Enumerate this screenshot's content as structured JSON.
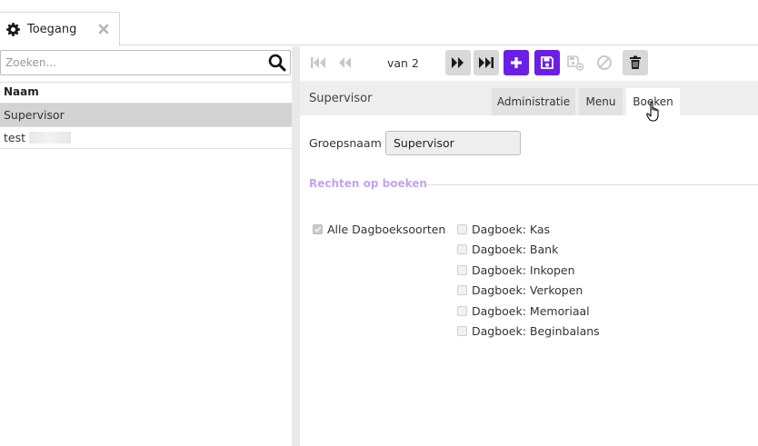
{
  "tabs": [
    {
      "label": "Toegang",
      "icon": "gear-icon",
      "closable": true
    }
  ],
  "left_panel": {
    "search": {
      "placeholder": "Zoeken...",
      "value": ""
    },
    "column_header": "Naam",
    "rows": [
      {
        "label": "Supervisor",
        "selected": true
      },
      {
        "label": "test",
        "selected": false
      }
    ]
  },
  "toolbar": {
    "page_text": "van 2",
    "buttons": [
      "first-page-icon",
      "previous-page-icon",
      "next-page-icon",
      "last-page-icon",
      "plus-icon",
      "save-icon",
      "save-as-icon",
      "cancel-icon",
      "trash-icon"
    ]
  },
  "detail": {
    "title": "Supervisor",
    "tabs": [
      {
        "label": "Administratie",
        "active": false
      },
      {
        "label": "Menu",
        "active": false
      },
      {
        "label": "Boeken",
        "active": true
      }
    ],
    "form": {
      "groepsnaam_label": "Groepsnaam",
      "groepsnaam_value": "Supervisor"
    },
    "section_title": "Rechten op boeken",
    "all_checkbox": {
      "label": "Alle Dagboeksoorten",
      "checked": true
    },
    "journal_checkboxes": [
      {
        "label": "Dagboek: Kas",
        "checked": false
      },
      {
        "label": "Dagboek: Bank",
        "checked": false
      },
      {
        "label": "Dagboek: Inkopen",
        "checked": false
      },
      {
        "label": "Dagboek: Verkopen",
        "checked": false
      },
      {
        "label": "Dagboek: Memoriaal",
        "checked": false
      },
      {
        "label": "Dagboek: Beginbalans",
        "checked": false
      }
    ]
  },
  "colors": {
    "accent": "#6a1fe6",
    "section_title": "#c4a3f2",
    "selected_row": "#d3d3d3"
  }
}
